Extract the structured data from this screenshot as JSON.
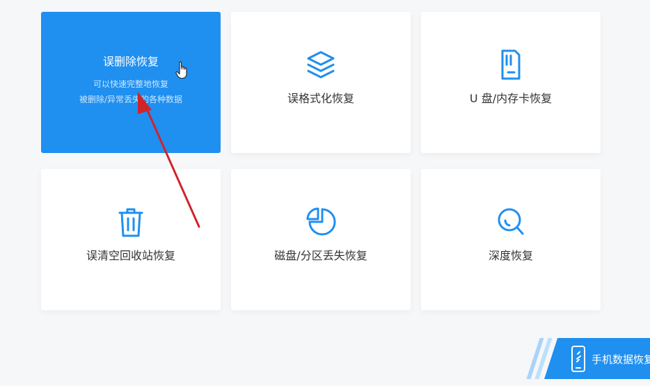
{
  "cards": [
    {
      "title": "误删除恢复",
      "desc_line1": "可以快速完整地恢复",
      "desc_line2": "被删除/异常丢失的各种数据",
      "active": true
    },
    {
      "label": "误格式化恢复",
      "icon": "layers-icon"
    },
    {
      "label": "U 盘/内存卡恢复",
      "icon": "sd-card-icon"
    },
    {
      "label": "误清空回收站恢复",
      "icon": "trash-icon"
    },
    {
      "label": "磁盘/分区丢失恢复",
      "icon": "pie-chart-icon"
    },
    {
      "label": "深度恢复",
      "icon": "magnifier-icon"
    }
  ],
  "mobile_recovery": {
    "label": "手机数据恢复",
    "icon": "phone-icon"
  },
  "colors": {
    "accent": "#1f8ff0",
    "icon_blue": "#1f8ff0",
    "annotation_arrow": "#d0242b",
    "background": "#f6f7f9"
  }
}
